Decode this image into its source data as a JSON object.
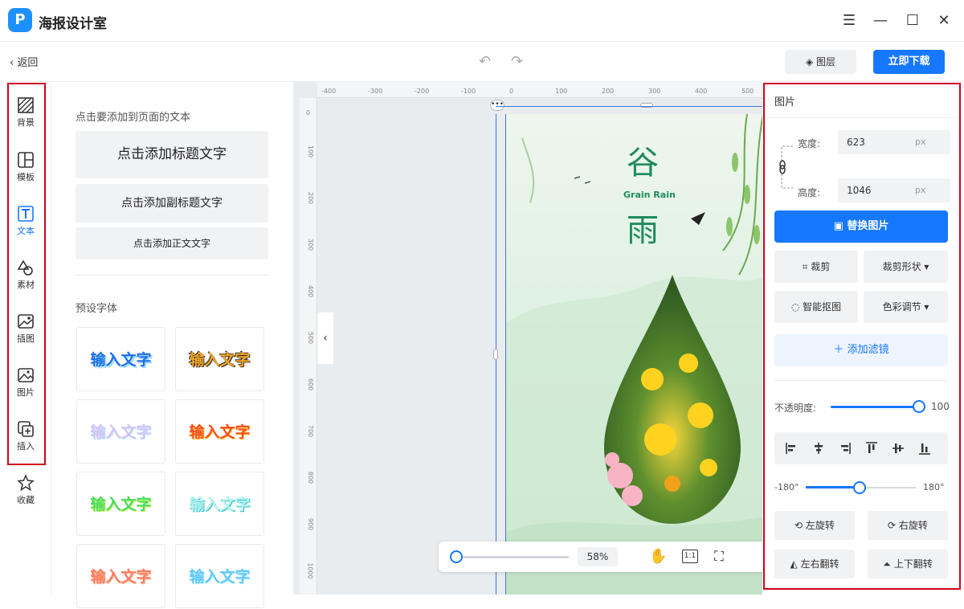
{
  "app": {
    "title": "海报设计室",
    "logo": "P"
  },
  "toolbar": {
    "back": "返回",
    "layers": "图层",
    "download": "立即下载"
  },
  "rail": [
    {
      "label": "背景",
      "icon": "background-icon"
    },
    {
      "label": "模板",
      "icon": "template-icon"
    },
    {
      "label": "文本",
      "icon": "text-icon",
      "active": true
    },
    {
      "label": "素材",
      "icon": "shapes-icon"
    },
    {
      "label": "插图",
      "icon": "illustration-icon"
    },
    {
      "label": "图片",
      "icon": "image-icon"
    },
    {
      "label": "插入",
      "icon": "insert-icon"
    },
    {
      "label": "收藏",
      "icon": "star-icon"
    }
  ],
  "text_panel": {
    "hint": "点击要添加到页面的文本",
    "add_title": "点击添加标题文字",
    "add_subtitle": "点击添加副标题文字",
    "add_body": "点击添加正文文字",
    "preset_title": "预设字体",
    "presets": [
      "输入文字",
      "输入文字",
      "输入文字",
      "输入文字",
      "输入文字",
      "输入文字",
      "输入文字",
      "输入文字"
    ]
  },
  "ruler": {
    "top": [
      "-400",
      "-300",
      "-200",
      "-100",
      "0",
      "100",
      "200",
      "300",
      "400",
      "500"
    ],
    "left": [
      "0",
      "100",
      "200",
      "300",
      "400",
      "500",
      "600",
      "700",
      "800",
      "900",
      "1000"
    ]
  },
  "poster": {
    "title1": "谷",
    "subtitle": "Grain Rain",
    "title2": "雨"
  },
  "zoom": {
    "value": "58%",
    "one_to_one": "1:1"
  },
  "image_panel": {
    "title": "图片",
    "width_label": "宽度:",
    "width_value": "623",
    "height_label": "高度:",
    "height_value": "1046",
    "unit": "px",
    "replace": "替换图片",
    "crop": "裁剪",
    "crop_shape": "裁剪形状",
    "smart_cutout": "智能抠图",
    "color_adjust": "色彩调节",
    "add_filter": "添加滤镜",
    "opacity_label": "不透明度:",
    "opacity_value": "100",
    "rotate_min": "-180°",
    "rotate_max": "180°",
    "rotate_left": "左旋转",
    "rotate_right": "右旋转",
    "flip_h": "左右翻转",
    "flip_v": "上下翻转"
  },
  "colors": {
    "accent": "#1677ff",
    "highlight_border": "#d0021b",
    "poster_green": "#1f8b5a"
  }
}
